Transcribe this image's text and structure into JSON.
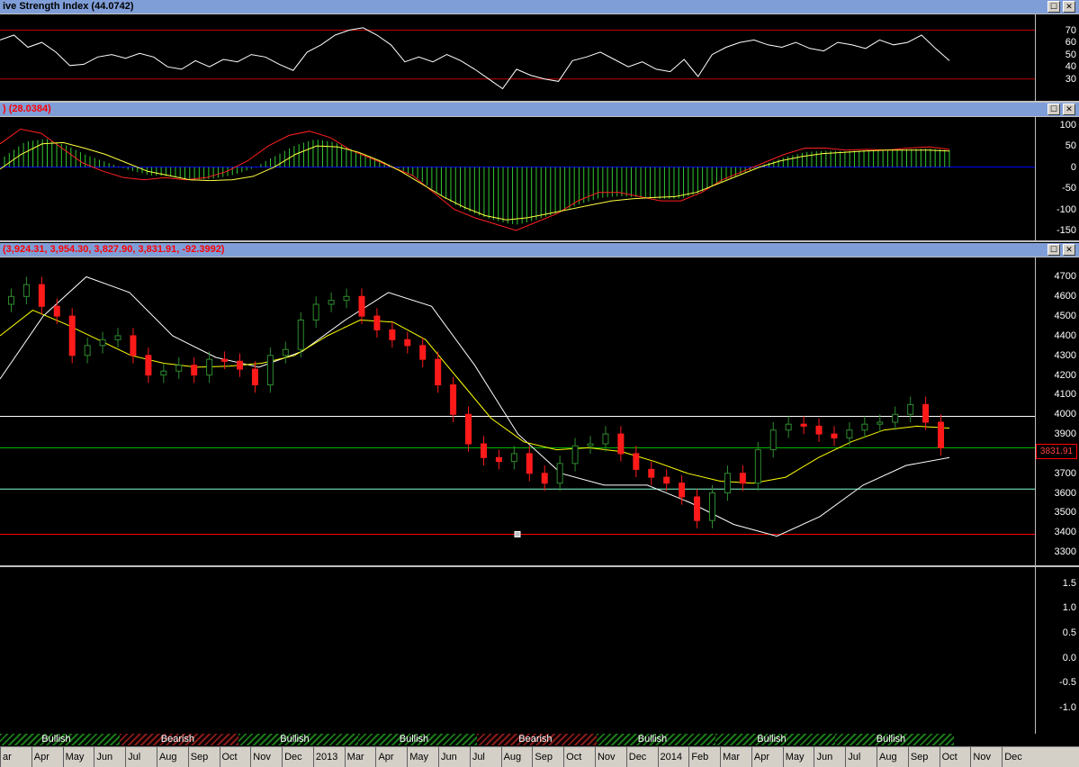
{
  "colors": {
    "up": "#2e8b2e",
    "down": "#ff1a1a",
    "ma_fast": "#ffff00",
    "ma_slow": "#ffffff",
    "rsi": "#ffffff",
    "macd": "#ff2020",
    "signal": "#ffff40",
    "hist": "#32c832",
    "band_top": "#ffffff",
    "band_mid": "#00c000",
    "band_low": "#80ffd0",
    "support": "#ff0000"
  },
  "window_buttons": {
    "maximize": "☐",
    "close": "✕"
  },
  "rsi_pane": {
    "title": "ive Strength Index (44.0742)",
    "ticks": [
      "70",
      "60",
      "50",
      "40",
      "30"
    ]
  },
  "macd_pane": {
    "title": ") (28.0384)",
    "ticks": [
      "100",
      "50",
      "0",
      "-50",
      "-100",
      "-150"
    ]
  },
  "price_pane": {
    "title": "(3,924.31, 3,954.30, 3,827.90, 3,831.91, -92.3992)",
    "ticks": [
      "4700",
      "4600",
      "4500",
      "4400",
      "4300",
      "4200",
      "4100",
      "4000",
      "3900",
      "3800",
      "3700",
      "3600",
      "3500",
      "3400",
      "3300"
    ],
    "last_value": "3831.91"
  },
  "empty_pane": {
    "ticks": [
      "1.5",
      "1.0",
      "0.5",
      "0.0",
      "-0.5",
      "-1.0"
    ]
  },
  "sentiment": [
    {
      "label": "Bullish",
      "type": "bull"
    },
    {
      "label": "Bearish",
      "type": "bear"
    },
    {
      "label": "Bullish",
      "type": "bull"
    },
    {
      "label": "Bullish",
      "type": "bull"
    },
    {
      "label": "Bearish",
      "type": "bear"
    },
    {
      "label": "Bullish",
      "type": "bull"
    },
    {
      "label": "Bullish",
      "type": "bull"
    },
    {
      "label": "Bullish",
      "type": "bull"
    }
  ],
  "timeline": [
    "ar",
    "Apr",
    "May",
    "Jun",
    "Jul",
    "Aug",
    "Sep",
    "Oct",
    "Nov",
    "Dec",
    "2013",
    "Mar",
    "Apr",
    "May",
    "Jun",
    "Jul",
    "Aug",
    "Sep",
    "Oct",
    "Nov",
    "Dec",
    "2014",
    "Feb",
    "Mar",
    "Apr",
    "May",
    "Jun",
    "Jul",
    "Aug",
    "Sep",
    "Oct",
    "Nov",
    "Dec"
  ],
  "chart_data": [
    {
      "type": "line",
      "title": "ive Strength Index (44.0742)",
      "ylim": [
        15,
        80
      ],
      "reference_lines": [
        70,
        30
      ],
      "series": [
        {
          "values": [
            62,
            66,
            56,
            60,
            52,
            41,
            42,
            48,
            50,
            47,
            51,
            48,
            40,
            38,
            45,
            40,
            46,
            44,
            50,
            48,
            42,
            37,
            52,
            58,
            66,
            70,
            72,
            66,
            58,
            44,
            48,
            44,
            50,
            45,
            38,
            30,
            22,
            38,
            33,
            30,
            28,
            45,
            48,
            52,
            46,
            40,
            44,
            38,
            36,
            46,
            32,
            50,
            56,
            60,
            62,
            58,
            56,
            60,
            55,
            53,
            60,
            58,
            55,
            62,
            58,
            60,
            66,
            55,
            45
          ]
        }
      ]
    },
    {
      "type": "line",
      "title": ") (28.0384)",
      "ylim": [
        -165,
        110
      ],
      "series": [
        {
          "values": [
            55,
            90,
            80,
            45,
            10,
            -10,
            -25,
            -30,
            -25,
            -30,
            -25,
            -10,
            15,
            50,
            75,
            85,
            70,
            40,
            20,
            0,
            -20,
            -60,
            -100,
            -120,
            -135,
            -150,
            -130,
            -110,
            -80,
            -60,
            -60,
            -70,
            -80,
            -80,
            -60,
            -30,
            -10,
            10,
            30,
            45,
            45,
            40,
            42,
            40,
            45,
            48,
            42
          ]
        },
        {
          "values": [
            -5,
            30,
            55,
            58,
            45,
            30,
            10,
            -10,
            -20,
            -30,
            -32,
            -30,
            -22,
            0,
            30,
            50,
            48,
            35,
            15,
            -10,
            -40,
            -70,
            -95,
            -115,
            -125,
            -120,
            -110,
            -100,
            -90,
            -80,
            -75,
            -72,
            -70,
            -60,
            -40,
            -20,
            0,
            15,
            25,
            32,
            35,
            38,
            40,
            40,
            40,
            38
          ]
        }
      ]
    },
    {
      "type": "candlestick",
      "title": "(3,924.31, 3,954.30, 3,827.90, 3,831.91, -92.3992)",
      "ylim": [
        3250,
        4780
      ],
      "last": 3831.91,
      "horizontal_levels": [
        3990,
        3830,
        3620,
        3390
      ],
      "ohlc_close": [
        4600,
        4660,
        4550,
        4500,
        4300,
        4350,
        4380,
        4400,
        4300,
        4200,
        4220,
        4250,
        4200,
        4280,
        4270,
        4230,
        4150,
        4300,
        4330,
        4480,
        4560,
        4580,
        4600,
        4500,
        4430,
        4380,
        4350,
        4280,
        4150,
        4000,
        3850,
        3780,
        3760,
        3800,
        3700,
        3650,
        3750,
        3840,
        3850,
        3900,
        3800,
        3720,
        3680,
        3650,
        3580,
        3460,
        3600,
        3700,
        3650,
        3820,
        3920,
        3950,
        3940,
        3900,
        3880,
        3920,
        3950,
        3960,
        4000,
        4050,
        3960,
        3830
      ],
      "ma_fast": [
        4400,
        4530,
        4460,
        4380,
        4300,
        4260,
        4240,
        4245,
        4260,
        4300,
        4400,
        4480,
        4470,
        4380,
        4180,
        3980,
        3860,
        3820,
        3830,
        3810,
        3760,
        3700,
        3660,
        3650,
        3680,
        3780,
        3860,
        3920,
        3940,
        3930
      ],
      "ma_slow": [
        4180,
        4500,
        4700,
        4620,
        4400,
        4290,
        4240,
        4320,
        4480,
        4620,
        4550,
        4250,
        3900,
        3700,
        3640,
        3640,
        3550,
        3440,
        3380,
        3480,
        3640,
        3740,
        3780
      ]
    }
  ]
}
